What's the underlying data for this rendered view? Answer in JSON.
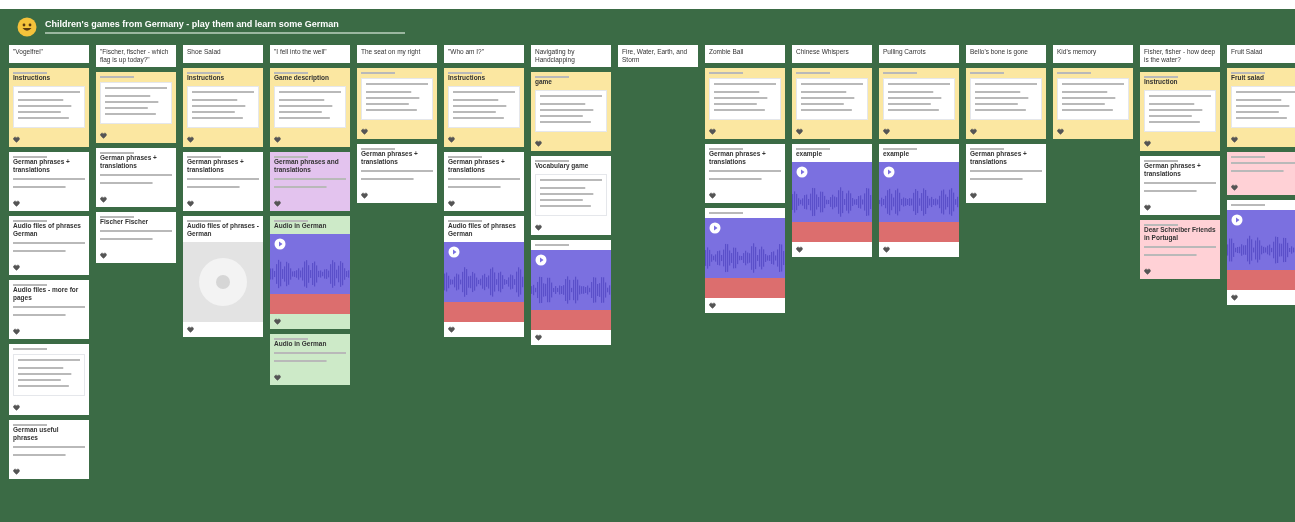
{
  "board": {
    "title": "Children's games from Germany - play them and learn some German"
  },
  "columns": [
    {
      "title": "\"Vogelfrei\"",
      "cards": [
        {
          "kind": "doc",
          "color": "#fbe7a1",
          "heading": "Instructions"
        },
        {
          "kind": "text",
          "color": "#ffffff",
          "heading": "German phrases + translations"
        },
        {
          "kind": "text",
          "color": "#ffffff",
          "heading": "Audio files of phrases German"
        },
        {
          "kind": "text",
          "color": "#ffffff",
          "heading": "Audio files - more for pages"
        },
        {
          "kind": "doc",
          "color": "#ffffff"
        },
        {
          "kind": "text",
          "color": "#ffffff",
          "heading": "German useful phrases"
        }
      ]
    },
    {
      "title": "\"Fischer, fischer - which flag is up today?\"",
      "cards": [
        {
          "kind": "doc",
          "color": "#fbe7a1"
        },
        {
          "kind": "text",
          "color": "#ffffff",
          "heading": "German phrases + translations"
        },
        {
          "kind": "text",
          "color": "#ffffff",
          "heading": "Fischer Fischer"
        }
      ]
    },
    {
      "title": "Shoe Salad",
      "cards": [
        {
          "kind": "doc",
          "color": "#fbe7a1",
          "heading": "Instructions"
        },
        {
          "kind": "text",
          "color": "#ffffff",
          "heading": "German phrases + translations"
        },
        {
          "kind": "disc",
          "color": "#ffffff",
          "heading": "Audio files of phrases - German"
        }
      ]
    },
    {
      "title": "\"I fell into the well\"",
      "cards": [
        {
          "kind": "doc",
          "color": "#fbe7a1",
          "heading": "Game description"
        },
        {
          "kind": "text",
          "color": "#e3c3ee",
          "heading": "German phrases and translations"
        },
        {
          "kind": "audio",
          "color": "#cdeac8",
          "heading": "Audio in German"
        },
        {
          "kind": "text",
          "color": "#cdeac8",
          "heading": "Audio in German"
        }
      ]
    },
    {
      "title": "The seat on my right",
      "cards": [
        {
          "kind": "doc",
          "color": "#fbe7a1"
        },
        {
          "kind": "text",
          "color": "#ffffff",
          "heading": "German phrases + translations"
        }
      ]
    },
    {
      "title": "\"Who am I?\"",
      "cards": [
        {
          "kind": "doc",
          "color": "#fbe7a1",
          "heading": "Instructions"
        },
        {
          "kind": "text",
          "color": "#ffffff",
          "heading": "German phrases + translations"
        },
        {
          "kind": "audio",
          "color": "#ffffff",
          "heading": "Audio files of phrases German"
        }
      ]
    },
    {
      "title": "Navigating by Handclapping",
      "cards": [
        {
          "kind": "doc",
          "color": "#fbe7a1",
          "heading": "game"
        },
        {
          "kind": "doc",
          "color": "#ffffff",
          "heading": "Vocabulary game"
        },
        {
          "kind": "audio",
          "color": "#ffffff"
        }
      ]
    },
    {
      "title": "Fire, Water, Earth, and Storm"
    },
    {
      "title": "Zombie Ball",
      "cards": [
        {
          "kind": "doc",
          "color": "#fbe7a1"
        },
        {
          "kind": "text",
          "color": "#ffffff",
          "heading": "German phrases + translations"
        },
        {
          "kind": "audio",
          "color": "#ffffff"
        }
      ]
    },
    {
      "title": "Chinese Whispers",
      "cards": [
        {
          "kind": "doc",
          "color": "#fbe7a1"
        },
        {
          "kind": "audio",
          "color": "#ffffff",
          "heading": "example"
        }
      ]
    },
    {
      "title": "Pulling Carrots",
      "cards": [
        {
          "kind": "doc",
          "color": "#fbe7a1"
        },
        {
          "kind": "audio",
          "color": "#ffffff",
          "heading": "example"
        }
      ]
    },
    {
      "title": "Bello's bone is gone",
      "cards": [
        {
          "kind": "doc",
          "color": "#fbe7a1"
        },
        {
          "kind": "text",
          "color": "#ffffff",
          "heading": "German phrases + translations"
        }
      ]
    },
    {
      "title": "Kid's memory",
      "cards": [
        {
          "kind": "doc",
          "color": "#fbe7a1"
        }
      ]
    },
    {
      "title": "Fisher, fisher - how deep is the water?",
      "cards": [
        {
          "kind": "doc",
          "color": "#fbe7a1",
          "heading": "Instruction"
        },
        {
          "kind": "text",
          "color": "#ffffff",
          "heading": "German phrases + translations"
        },
        {
          "kind": "text",
          "color": "#ffd1d6",
          "heading": "Dear Schreiber Friends in Portugal"
        }
      ]
    },
    {
      "title": "Fruit Salad",
      "cards": [
        {
          "kind": "doc",
          "color": "#fbe7a1",
          "heading": "Fruit salad"
        },
        {
          "kind": "text",
          "color": "#ffd1d6"
        },
        {
          "kind": "audio",
          "color": "#ffffff"
        }
      ]
    }
  ]
}
